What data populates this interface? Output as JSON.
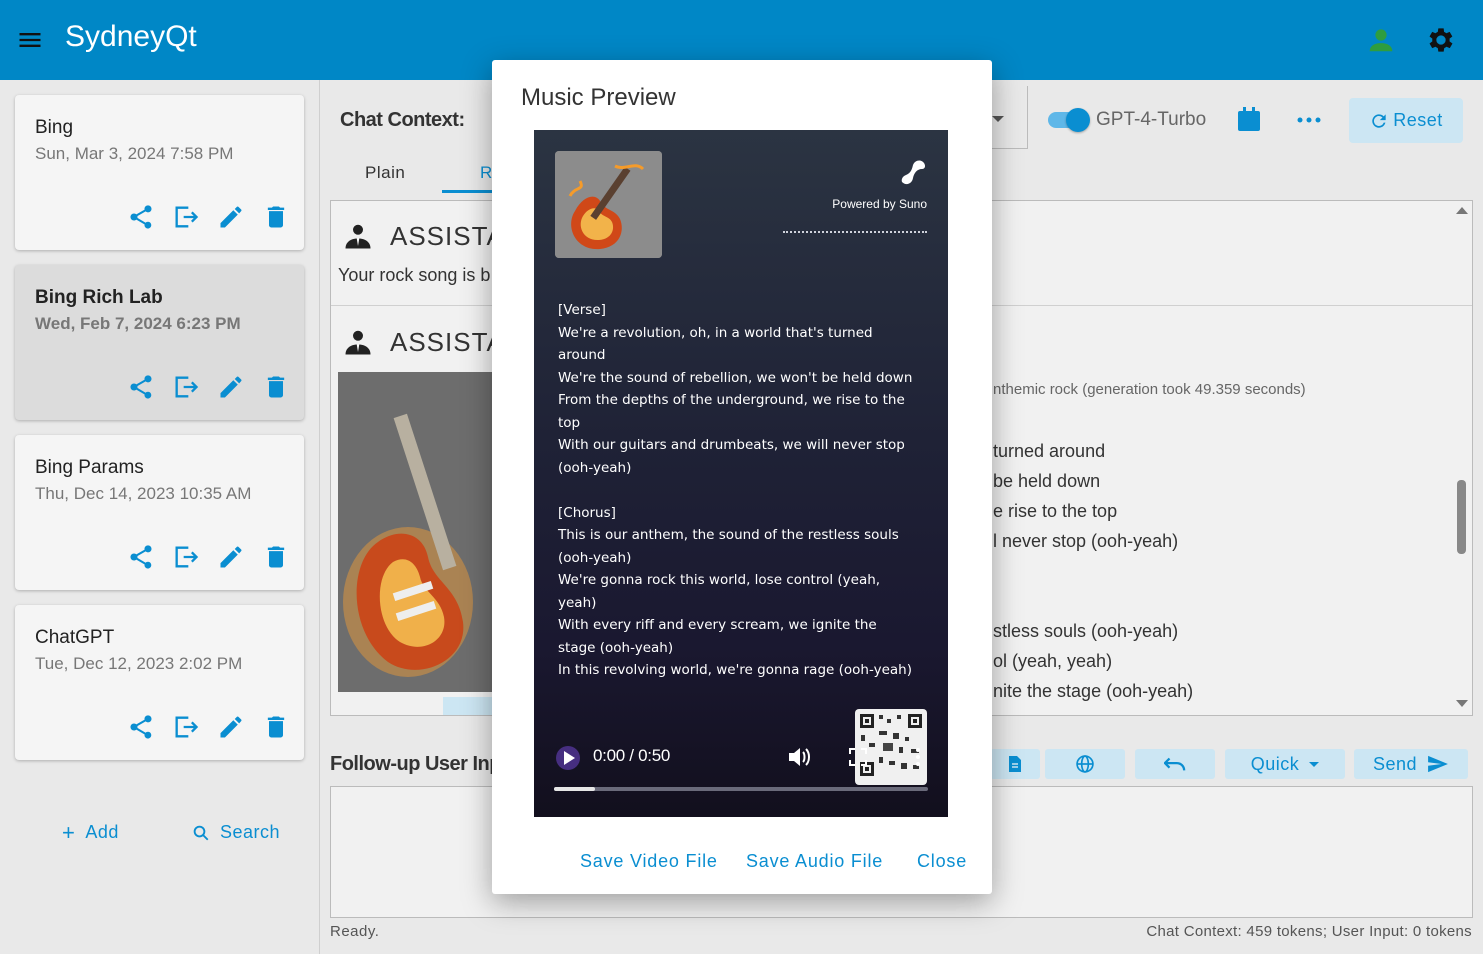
{
  "app": {
    "title": "SydneyQt"
  },
  "sidebar": {
    "items": [
      {
        "title": "Bing",
        "date": "Sun, Mar 3, 2024 7:58 PM"
      },
      {
        "title": "Bing Rich Lab",
        "date": "Wed, Feb 7, 2024 6:23 PM"
      },
      {
        "title": "Bing Params",
        "date": "Thu, Dec 14, 2023 10:35 AM"
      },
      {
        "title": "ChatGPT",
        "date": "Tue, Dec 12, 2023 2:02 PM"
      }
    ],
    "add_label": "Add",
    "search_label": "Search"
  },
  "main": {
    "context_label": "Chat Context:",
    "tabs": [
      {
        "label": "Plain"
      },
      {
        "label": "R"
      }
    ],
    "model_label": "GPT-4-Turbo",
    "reset_label": "Reset",
    "messages": [
      {
        "role": "ASSISTA",
        "text": "Your rock song is b"
      },
      {
        "role": "ASSISTA"
      }
    ],
    "generation_note": "nthemic rock (generation took 49.359 seconds)",
    "right_lines": [
      "turned around",
      "be held down",
      "e rise to the top",
      "l never stop (ooh-yeah)",
      "stless souls (ooh-yeah)",
      "ol (yeah, yeah)",
      "nite the stage (ooh-yeah)"
    ],
    "followup_label": "Follow-up User Input:",
    "quick_label": "Quick",
    "send_label": "Send",
    "status_left": "Ready.",
    "status_right": "Chat Context: 459 tokens; User Input: 0 tokens"
  },
  "dialog": {
    "title": "Music Preview",
    "powered_by": "Powered by Suno",
    "lyrics": "[Verse]\nWe're a revolution, oh, in a world that's turned\naround\nWe're the sound of rebellion, we won't be held down\nFrom the depths of the underground, we rise to the\ntop\nWith our guitars and drumbeats, we will never stop\n(ooh-yeah)\n\n[Chorus]\nThis is our anthem, the sound of the restless souls\n(ooh-yeah)\nWe're gonna rock this world, lose control (yeah,\nyeah)\nWith every riff and every scream, we ignite the\nstage (ooh-yeah)\nIn this revolving world, we're gonna rage (ooh-yeah)",
    "time": "0:00 / 0:50",
    "progress": 0.11,
    "buttons": {
      "save_video": "Save Video File",
      "save_audio": "Save Audio File",
      "close": "Close"
    }
  },
  "colors": {
    "accent": "#0a8ed1",
    "appbar": "#0087c6",
    "user": "#2e9d3f"
  }
}
